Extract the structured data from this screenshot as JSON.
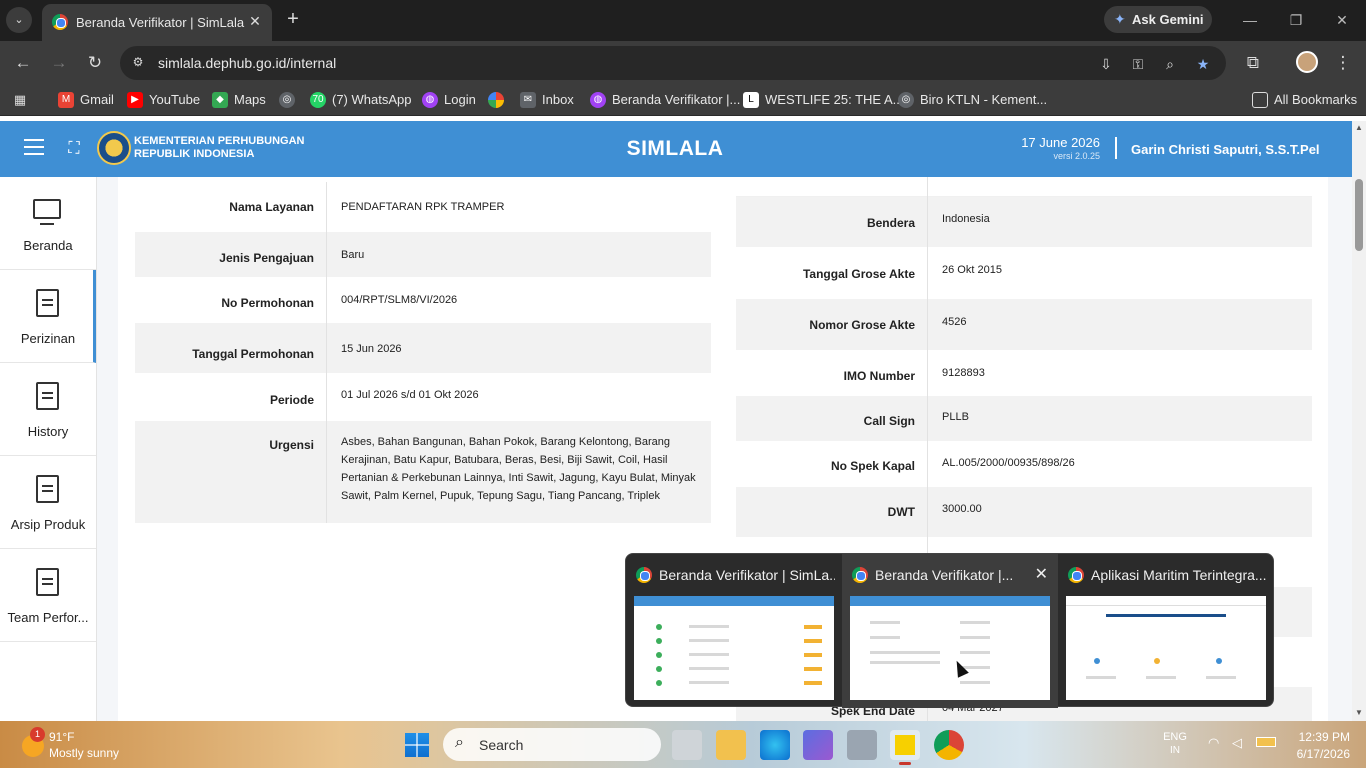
{
  "browser": {
    "active_tab_title": "Beranda Verifikator | SimLala",
    "url": "simlala.dephub.go.id/internal",
    "ask_gemini": "Ask Gemini",
    "bookmarks": [
      {
        "label": "Gmail",
        "color": "#ea4335"
      },
      {
        "label": "YouTube",
        "color": "#ff0000"
      },
      {
        "label": "Maps",
        "color": "#34a853"
      },
      {
        "label": "",
        "color": "#9aa0a6"
      },
      {
        "label": "(7) WhatsApp",
        "color": "#25d366"
      },
      {
        "label": "Login",
        "color": "#a142f4"
      },
      {
        "label": "",
        "color": "#fbbc04"
      },
      {
        "label": "Inbox",
        "color": "#9aa0a6"
      },
      {
        "label": "Beranda Verifikator |...",
        "color": "#a142f4"
      },
      {
        "label": "WESTLIFE 25: THE A...",
        "color": "#ffffff"
      },
      {
        "label": "Biro KTLN - Kement...",
        "color": "#9aa0a6"
      }
    ],
    "all_bookmarks": "All Bookmarks"
  },
  "header": {
    "ministry_line1": "KEMENTERIAN PERHUBUNGAN",
    "ministry_line2": "REPUBLIK INDONESIA",
    "app_title": "SIMLALA",
    "date": "17 June 2026",
    "version": "versi 2.0.25",
    "user": "Garin Christi Saputri, S.S.T.Pel"
  },
  "sidebar": {
    "items": [
      {
        "label": "Beranda",
        "icon": "monitor-icon"
      },
      {
        "label": "Perizinan",
        "icon": "document-icon"
      },
      {
        "label": "History",
        "icon": "document-icon"
      },
      {
        "label": "Arsip Produk",
        "icon": "document-icon"
      },
      {
        "label": "Team Perfor...",
        "icon": "document-icon"
      }
    ]
  },
  "left_table": [
    {
      "key": "Nama Layanan",
      "value": "PENDAFTARAN RPK TRAMPER"
    },
    {
      "key": "Jenis Pengajuan",
      "value": "Baru"
    },
    {
      "key": "No Permohonan",
      "value": "004/RPT/SLM8/VI/2026"
    },
    {
      "key": "Tanggal Permohonan",
      "value": "15 Jun 2026"
    },
    {
      "key": "Periode",
      "value": "01 Jul 2026 s/d 01 Okt 2026"
    },
    {
      "key": "Urgensi",
      "value": "Asbes, Bahan Bangunan, Bahan Pokok, Barang Kelontong, Barang Kerajinan, Batu Kapur, Batubara, Beras, Besi, Biji Sawit, Coil, Hasil Pertanian & Perkebunan Lainnya, Inti Sawit, Jagung, Kayu Bulat, Minyak Sawit, Palm Kernel, Pupuk, Tepung Sagu, Tiang Pancang, Triplek"
    }
  ],
  "right_table": [
    {
      "key": "Bendera",
      "value": "Indonesia"
    },
    {
      "key": "Tanggal Grose Akte",
      "value": "26 Okt 2015"
    },
    {
      "key": "Nomor Grose Akte",
      "value": "4526"
    },
    {
      "key": "IMO Number",
      "value": "9128893"
    },
    {
      "key": "Call Sign",
      "value": "PLLB"
    },
    {
      "key": "No Spek Kapal",
      "value": "AL.005/2000/00935/898/26"
    },
    {
      "key": "DWT",
      "value": "3000.00"
    },
    {
      "key": "Spek End Date",
      "value": "04 Mar 2027"
    }
  ],
  "thumbnails": [
    {
      "title": "Beranda Verifikator | SimLa..."
    },
    {
      "title": "Beranda Verifikator |..."
    },
    {
      "title": "Aplikasi Maritim Terintegra..."
    }
  ],
  "taskbar": {
    "weather_temp": "91°F",
    "weather_desc": "Mostly sunny",
    "weather_badge": "1",
    "search_placeholder": "Search",
    "lang": "ENG",
    "lang_region": "IN",
    "time": "12:39 PM",
    "date": "6/17/2026"
  }
}
